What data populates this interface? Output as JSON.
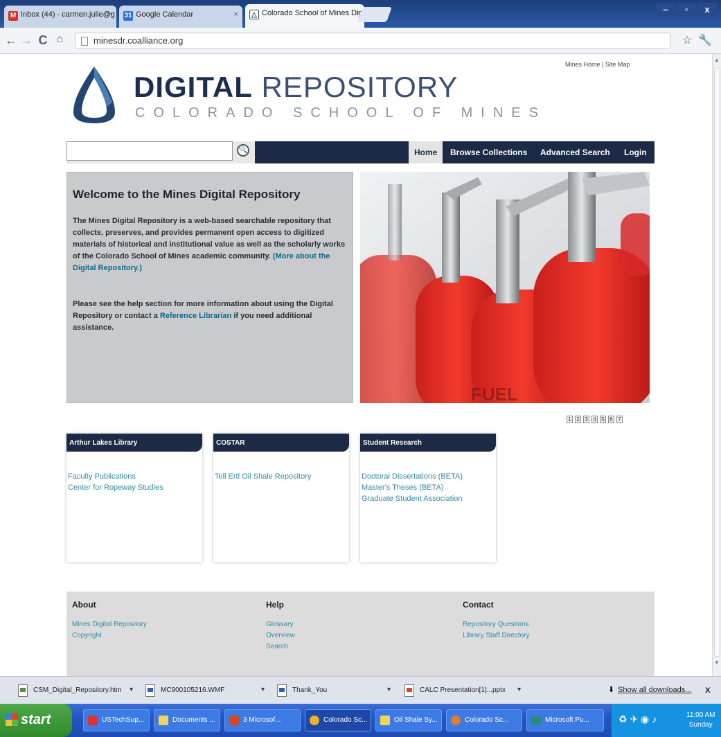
{
  "browser": {
    "tabs": [
      {
        "title": "Inbox (44) - carmen.julie@g",
        "icon": "gmail-icon"
      },
      {
        "title": "Google Calendar",
        "icon": "calendar-icon"
      },
      {
        "title": "Colorado School of Mines Dig",
        "icon": "mines-logo-icon"
      }
    ],
    "url": "minesdr.coalliance.org",
    "window_controls": [
      "–",
      "▫",
      "x"
    ]
  },
  "site": {
    "title_bold": "DIGITAL",
    "title_light": " REPOSITORY",
    "subtitle": "COLORADO SCHOOL OF MINES",
    "toplinks": "Mines Home | Site Map",
    "search_placeholder": "",
    "nav": [
      "Home",
      "Browse Collections",
      "Advanced Search",
      "Login"
    ],
    "welcome": {
      "heading": "Welcome to the Mines Digital Repository",
      "p1": "The Mines Digital Repository is a web-based searchable repository that collects, preserves, and provides permanent open access to digitized materials of historical and institutional value as well as the scholarly works of the Colorado School of Mines academic community.",
      "p1_link": "(More about the Digital Repository.)",
      "p2_a": "Please see the help section for more information about using the Digital Repository or contact a",
      "p2_link": "Reference Librarian",
      "p2_b": "if you need additional assistance."
    },
    "slideshow_pages": [
      "1",
      "2",
      "3",
      "4",
      "5",
      "6",
      "7"
    ],
    "collections": [
      {
        "heading": "Arthur Lakes Library",
        "links": [
          "Faculty Publications",
          "Center for Ropeway Studies"
        ]
      },
      {
        "heading": "COSTAR",
        "links": [
          "Tell Ertl Oil Shale Repository"
        ]
      },
      {
        "heading": "Student Research",
        "links": [
          "Doctoral Dissertations (BETA)",
          "Master's Theses (BETA)",
          "Graduate Student Association"
        ]
      }
    ],
    "footer": [
      {
        "heading": "About",
        "links": [
          "Mines Digital Repository",
          "Copyright"
        ]
      },
      {
        "heading": "Help",
        "links": [
          "Glossary",
          "Overview",
          "Search"
        ]
      },
      {
        "heading": "Contact",
        "links": [
          "Repository Questions",
          "Library Staff Directory"
        ]
      }
    ]
  },
  "downloads": {
    "items": [
      "CSM_Digital_Repository.htm",
      "MC900105216.WMF",
      "Thank_You",
      "CALC Presentation[1]...pptx"
    ],
    "show_all": "Show all downloads...",
    "close": "x"
  },
  "taskbar": {
    "start": "start",
    "items": [
      "USTechSup...",
      "Documents ...",
      "3 Microsof...",
      "Colorado Sc...",
      "Oil Shale Sy...",
      "Colorado Sc...",
      "Microsoft Pu..."
    ],
    "clock_time": "11:00 AM",
    "clock_day": "Sunday"
  },
  "colors": {
    "navy": "#1c2a45",
    "link": "#2f8aa6",
    "taskbar": "#2456c4"
  }
}
